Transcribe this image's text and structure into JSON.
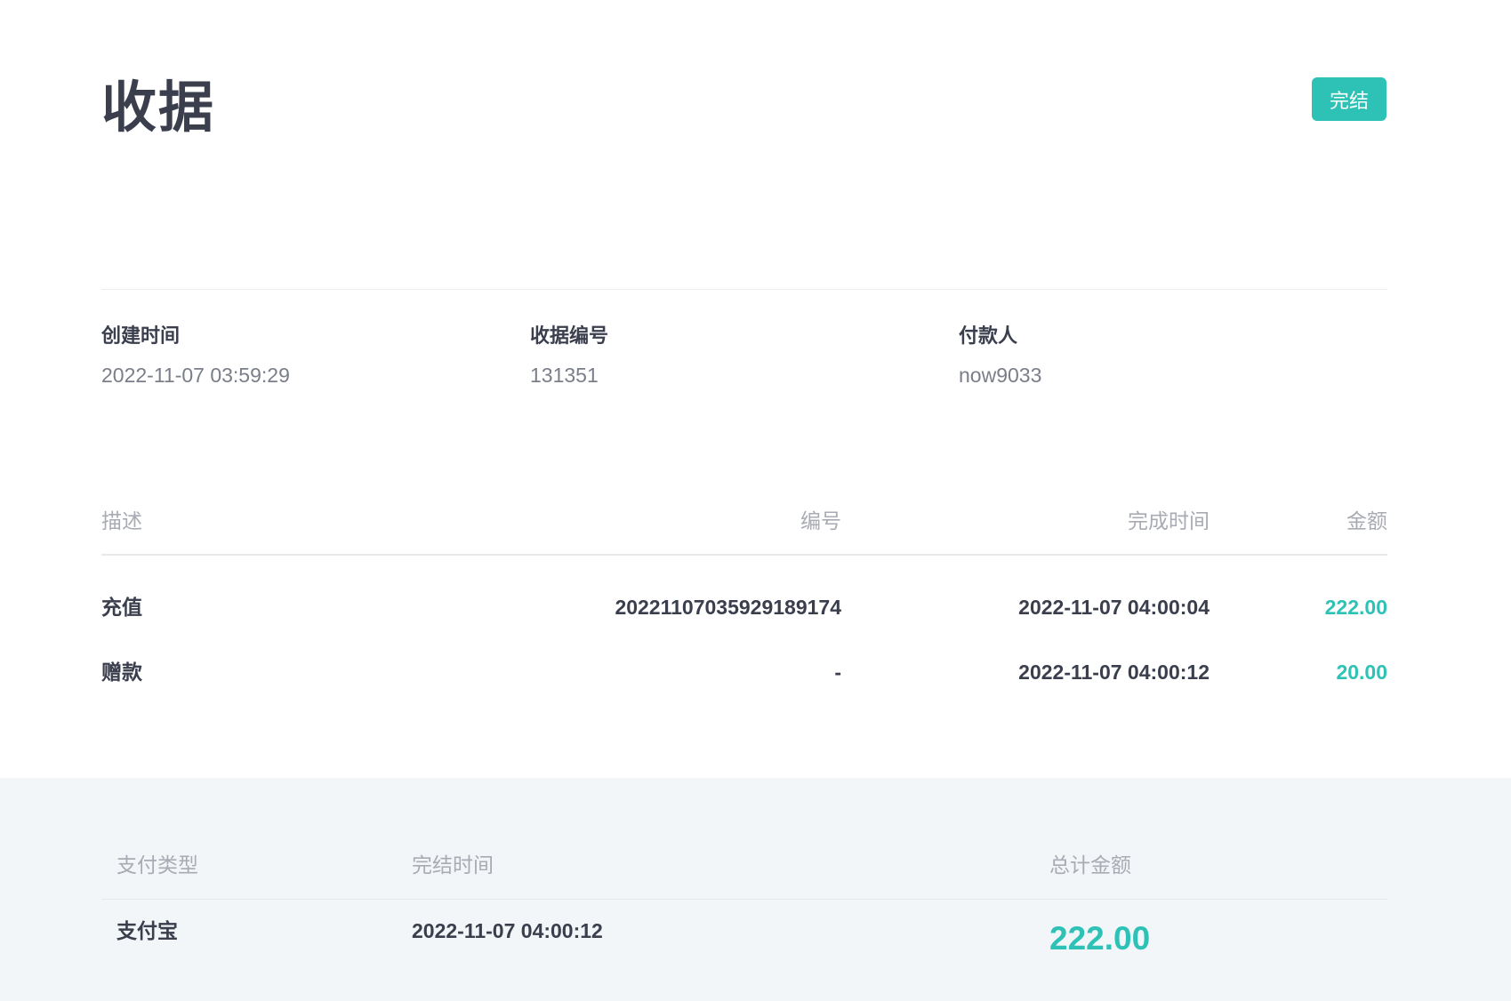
{
  "header": {
    "title": "收据",
    "status": "完结"
  },
  "meta": [
    {
      "label": "创建时间",
      "value": "2022-11-07 03:59:29"
    },
    {
      "label": "收据编号",
      "value": "131351"
    },
    {
      "label": "付款人",
      "value": "now9033"
    }
  ],
  "items": {
    "columns": {
      "description": "描述",
      "number": "编号",
      "completed_time": "完成时间",
      "amount": "金额"
    },
    "rows": [
      {
        "description": "充值",
        "number": "20221107035929189174",
        "completed_time": "2022-11-07 04:00:04",
        "amount": "222.00"
      },
      {
        "description": "赠款",
        "number": "-",
        "completed_time": "2022-11-07 04:00:12",
        "amount": "20.00"
      }
    ]
  },
  "summary": {
    "columns": {
      "payment_type": "支付类型",
      "finished_time": "完结时间",
      "total": "总计金额"
    },
    "payment_type": "支付宝",
    "finished_time": "2022-11-07 04:00:12",
    "total": "222.00"
  },
  "colors": {
    "accent": "#2ec2b6",
    "text_dark": "#3a3e4d",
    "text_muted": "#a8abb3",
    "summary_bg": "#f3f6f8"
  }
}
